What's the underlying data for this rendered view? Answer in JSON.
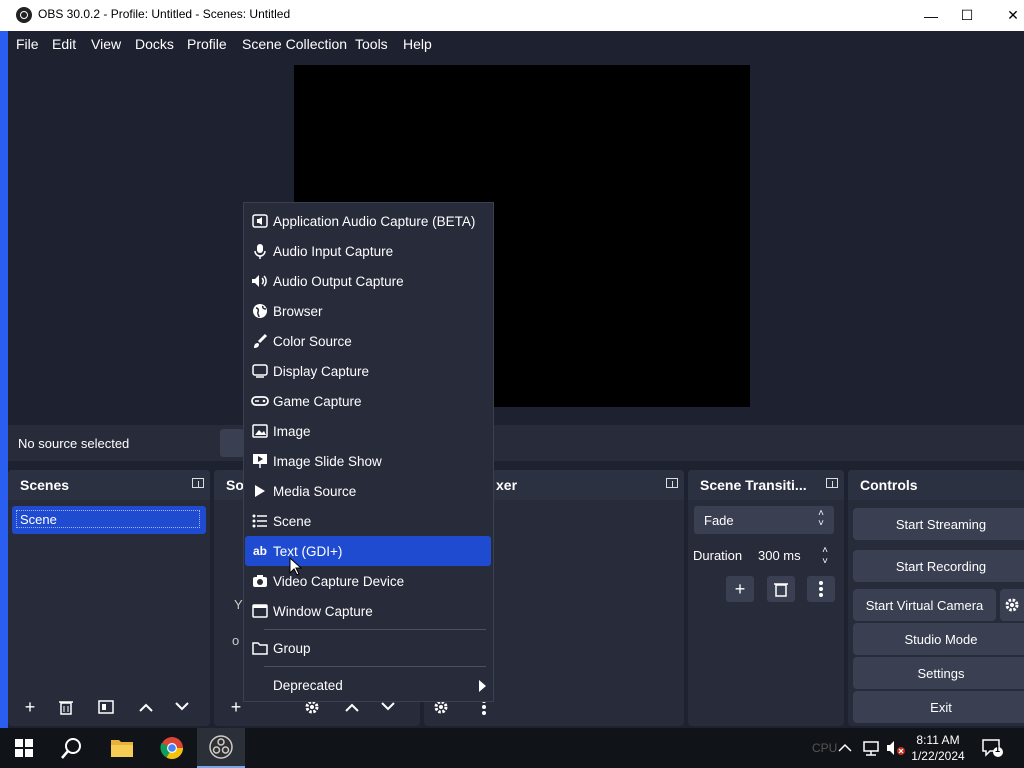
{
  "window": {
    "title": "OBS 30.0.2 - Profile: Untitled - Scenes: Untitled",
    "minimize": "—",
    "maximize": "☐",
    "close": "✕"
  },
  "menubar": [
    "File",
    "Edit",
    "View",
    "Docks",
    "Profile",
    "Scene Collection",
    "Tools",
    "Help"
  ],
  "source_bar": {
    "status": "No source selected"
  },
  "scenes": {
    "title": "Scenes",
    "items": [
      "Scene"
    ]
  },
  "sources": {
    "title_partial": "So",
    "partial_text_1": "Y",
    "partial_text_2": "o"
  },
  "mixer": {
    "title_partial": "xer"
  },
  "transitions": {
    "title": "Scene Transiti...",
    "selected": "Fade",
    "duration_label": "Duration",
    "duration_value": "300 ms"
  },
  "controls": {
    "title": "Controls",
    "buttons": [
      "Start Streaming",
      "Start Recording",
      "Start Virtual Camera",
      "Studio Mode",
      "Settings",
      "Exit"
    ]
  },
  "context_menu": {
    "items": [
      {
        "label": "Application Audio Capture (BETA)",
        "icon": "app-audio-icon"
      },
      {
        "label": "Audio Input Capture",
        "icon": "microphone-icon"
      },
      {
        "label": "Audio Output Capture",
        "icon": "speaker-icon"
      },
      {
        "label": "Browser",
        "icon": "globe-icon"
      },
      {
        "label": "Color Source",
        "icon": "brush-icon"
      },
      {
        "label": "Display Capture",
        "icon": "monitor-icon"
      },
      {
        "label": "Game Capture",
        "icon": "gamepad-icon"
      },
      {
        "label": "Image",
        "icon": "image-icon"
      },
      {
        "label": "Image Slide Show",
        "icon": "slideshow-icon"
      },
      {
        "label": "Media Source",
        "icon": "play-icon"
      },
      {
        "label": "Scene",
        "icon": "list-icon"
      },
      {
        "label": "Text (GDI+)",
        "icon": "text-icon",
        "highlighted": true
      },
      {
        "label": "Video Capture Device",
        "icon": "camera-icon"
      },
      {
        "label": "Window Capture",
        "icon": "window-icon"
      }
    ],
    "group": {
      "label": "Group",
      "icon": "folder-icon"
    },
    "deprecated": {
      "label": "Deprecated"
    }
  },
  "taskbar": {
    "time": "8:11 AM",
    "date": "1/22/2024",
    "notification_count": "1",
    "faded": {
      "a": "CPU"
    }
  },
  "colors": {
    "accent": "#1f4bd1",
    "panel": "#272b3a",
    "background": "#1e2230"
  }
}
